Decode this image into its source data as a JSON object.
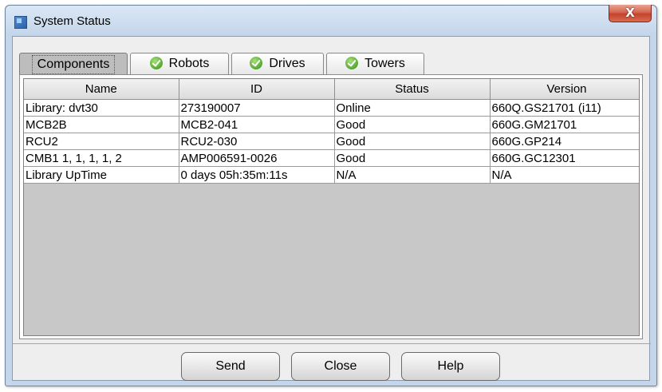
{
  "window": {
    "title": "System Status",
    "close_glyph": "X"
  },
  "tabs": [
    {
      "label": "Components",
      "active": true,
      "icon": null
    },
    {
      "label": "Robots",
      "active": false,
      "icon": "check-circle-icon"
    },
    {
      "label": "Drives",
      "active": false,
      "icon": "check-circle-icon"
    },
    {
      "label": "Towers",
      "active": false,
      "icon": "check-circle-icon"
    }
  ],
  "table": {
    "columns": [
      "Name",
      "ID",
      "Status",
      "Version"
    ],
    "rows": [
      [
        "Library: dvt30",
        "273190007",
        "Online",
        "660Q.GS21701 (i11)"
      ],
      [
        "MCB2B",
        "MCB2-041",
        "Good",
        "660G.GM21701"
      ],
      [
        "RCU2",
        "RCU2-030",
        "Good",
        "660G.GP214"
      ],
      [
        "CMB1 1, 1, 1, 1, 2",
        "AMP006591-0026",
        "Good",
        "660G.GC12301"
      ],
      [
        "Library UpTime",
        "0 days 05h:35m:11s",
        "N/A",
        "N/A"
      ]
    ]
  },
  "buttons": {
    "send": "Send",
    "close": "Close",
    "help": "Help"
  },
  "colors": {
    "frame": "#c6d6ea",
    "close_button": "#c4432c",
    "check_icon": "#5fb03a",
    "empty_table_area": "#c8c8c8"
  }
}
